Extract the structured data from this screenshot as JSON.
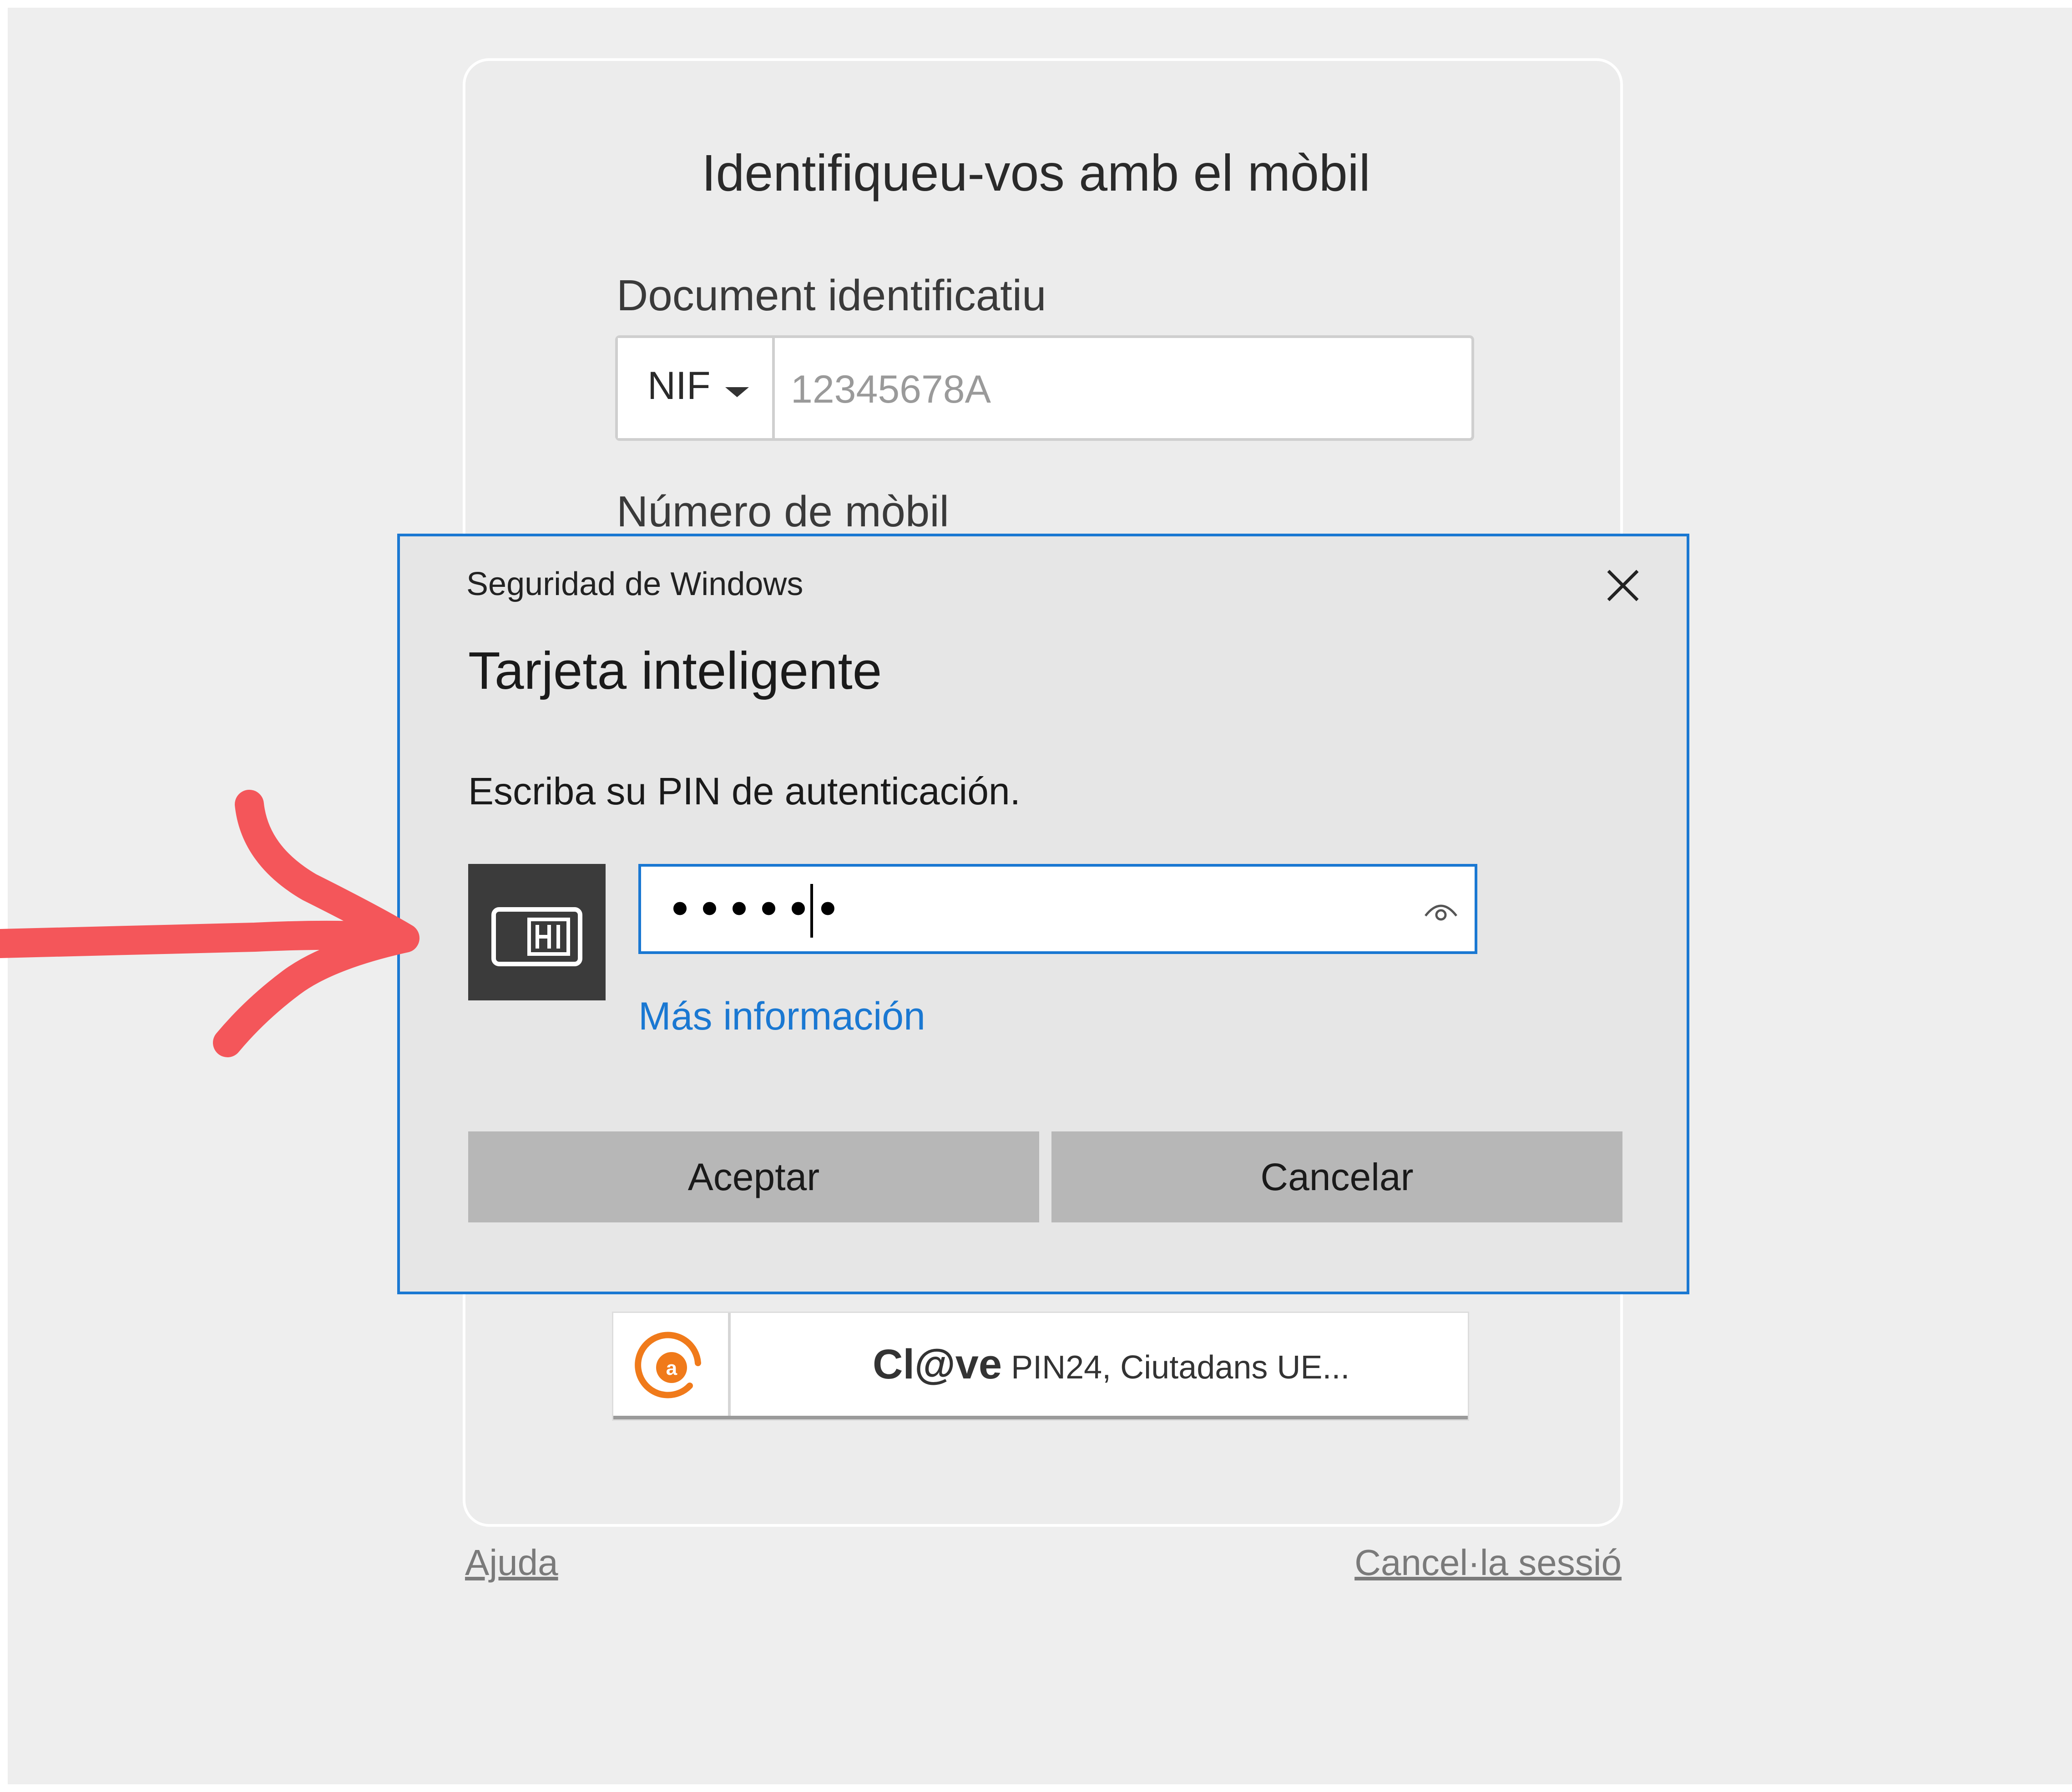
{
  "login": {
    "title": "Identifiqueu-vos amb el mòbil",
    "document_label": "Document identificatiu",
    "document_type": "NIF",
    "document_placeholder": "12345678A",
    "mobile_label": "Número de mòbil",
    "clave_brand": "Cl@ve",
    "clave_text": "PIN24, Ciutadans UE...",
    "help_link": "Ajuda",
    "logout_link": "Cancel·la sessió"
  },
  "dialog": {
    "window_title": "Seguridad de Windows",
    "heading": "Tarjeta inteligente",
    "prompt": "Escriba su PIN de autenticación.",
    "pin_value": "••••••",
    "more_info": "Más información",
    "accept_label": "Aceptar",
    "cancel_label": "Cancelar"
  },
  "colors": {
    "accent": "#1a78d2",
    "arrow": "#f4565a",
    "clave_orange": "#f07a1a"
  },
  "icons": {
    "close": "close-icon",
    "smartcard": "smart-card-icon",
    "reveal": "eye-icon",
    "dropdown": "caret-down-icon",
    "clave": "clave-logo-icon",
    "annotation": "arrow-annotation-icon"
  }
}
